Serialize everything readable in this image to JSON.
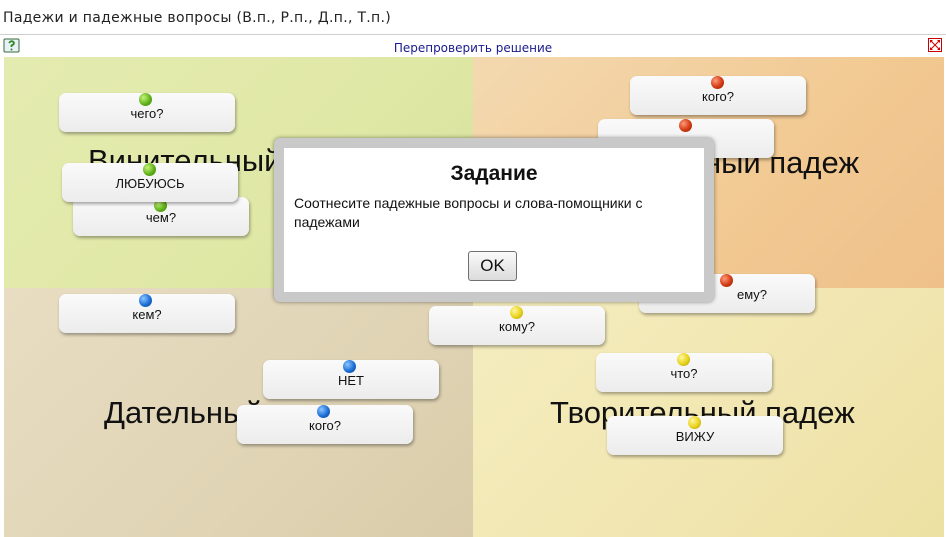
{
  "window": {
    "title": "Падежи и падежные вопросы (В.п., Р.п., Д.п., Т.п.)"
  },
  "toolbar": {
    "recheck_label": "Перепроверить решение",
    "help_icon": "help-icon",
    "fullscreen_icon": "fullscreen-icon"
  },
  "quadrants": {
    "accusative": "Винительный",
    "genitive": "ный падеж",
    "dative": "Дательный",
    "instrumental": "Творительный падеж"
  },
  "cards": {
    "c1": "чего?",
    "c2": "ЛЮБУЮСЬ",
    "c3": "чем?",
    "c4": "кем?",
    "c5": "кого?",
    "c6": "",
    "c7": "ему?",
    "c8": "кому?",
    "c9": "НЕТ",
    "c10": "кого?",
    "c11": "что?",
    "c12": "ВИЖУ"
  },
  "pin_colors": {
    "green": "#5fb319",
    "red": "#d23a12",
    "blue": "#1b6fd6",
    "yellow": "#e8d21a"
  },
  "dialog": {
    "title": "Задание",
    "message": "Соотнесите падежные вопросы и слова-помощники с падежами",
    "ok_label": "OK"
  }
}
